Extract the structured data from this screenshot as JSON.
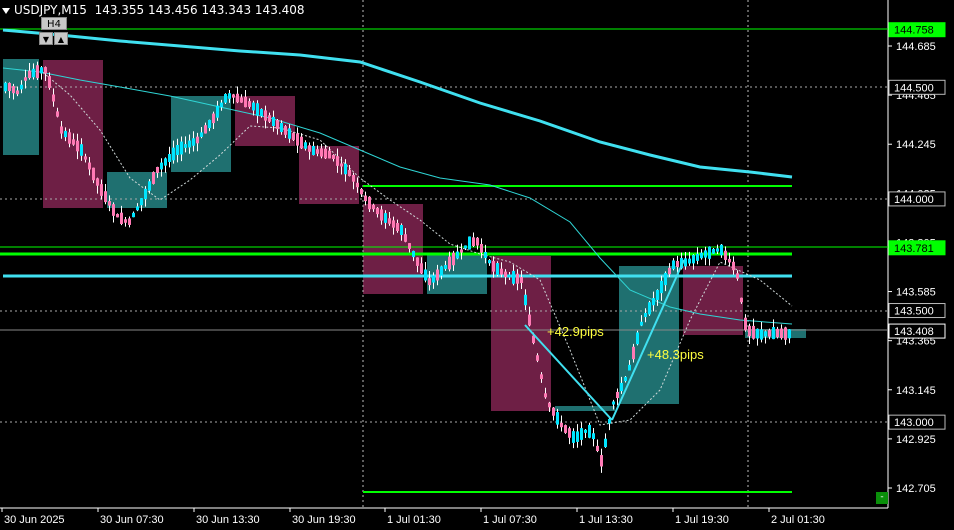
{
  "header": {
    "symbol": "USDJPY,M15",
    "open": "143.355",
    "high": "143.456",
    "low": "143.343",
    "close": "143.408"
  },
  "timeframe": {
    "label": "H4",
    "down_button": "▼",
    "up_button": "▲"
  },
  "corner_button": "-",
  "axis": {
    "y_ticks": [
      "144.685",
      "144.465",
      "144.245",
      "144.025",
      "143.805",
      "143.585",
      "143.365",
      "143.145",
      "142.925",
      "142.705"
    ],
    "x_ticks": [
      "30 Jun 2025",
      "30 Jun 07:30",
      "30 Jun 13:30",
      "30 Jun 19:30",
      "1 Jul 01:30",
      "1 Jul 07:30",
      "1 Jul 13:30",
      "1 Jul 19:30",
      "2 Jul 01:30"
    ]
  },
  "price_labels": [
    {
      "text": "144.758",
      "style": "green"
    },
    {
      "text": "144.500",
      "style": "gray"
    },
    {
      "text": "144.000",
      "style": "gray"
    },
    {
      "text": "143.781",
      "style": "green"
    },
    {
      "text": "143.500",
      "style": "gray"
    },
    {
      "text": "143.408",
      "style": "current"
    },
    {
      "text": "143.000",
      "style": "gray"
    }
  ],
  "annotations": [
    "+42.9pips",
    "+48.3pips"
  ],
  "colors": {
    "bull": "#00e5ff",
    "bear": "#ff79b4",
    "h4_bull": "#1f7070",
    "h4_bear": "#6e1f45",
    "level": "#00ff00",
    "ma": "#40e0f0",
    "label_text": "#ffff40"
  }
}
